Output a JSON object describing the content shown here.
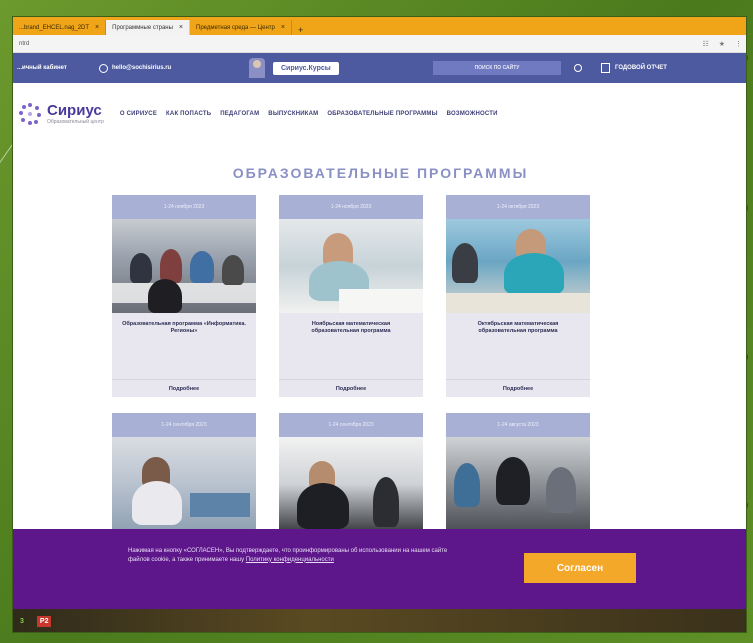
{
  "browser": {
    "tabs": [
      {
        "label": "...brand_EHCEL.nag_2DT",
        "active": false
      },
      {
        "label": "Программные страны",
        "active": true
      },
      {
        "label": "Предметная среда — Центр",
        "active": false
      }
    ],
    "new_tab": "+",
    "address": "ntrd"
  },
  "topbar": {
    "cabinet": "...ичный кабинет",
    "email": "hello@sochisirius.ru",
    "brand_button": "Сириус.Курсы",
    "search_placeholder": "ПОИСК ПО САЙТУ",
    "report": "ГОДОВОЙ ОТЧЕТ"
  },
  "site": {
    "logo_name": "Сириус",
    "logo_sub": "Образовательный центр",
    "nav": [
      "О СИРИУСЕ",
      "КАК ПОПАСТЬ",
      "ПЕДАГОГАМ",
      "ВЫПУСКНИКАМ",
      "ОБРАЗОВАТЕЛЬНЫЕ ПРОГРАММЫ",
      "ВОЗМОЖНОСТИ"
    ]
  },
  "page_title": "ОБРАЗОВАТЕЛЬНЫЕ ПРОГРАММЫ",
  "cards": [
    {
      "date": "1-24 ноября 2023",
      "title": "Образовательная программа «Информатика. Регионы»",
      "more": "Подробнее"
    },
    {
      "date": "1-24 ноября 2023",
      "title": "Ноябрьская математическая образовательная программа",
      "more": "Подробнее"
    },
    {
      "date": "1-24 октября 2023",
      "title": "Октябрьская математическая образовательная программа",
      "more": "Подробнее"
    },
    {
      "date": "1-24 сентября 2023",
      "title": "",
      "more": ""
    },
    {
      "date": "1-24 сентября 2023",
      "title": "",
      "more": ""
    },
    {
      "date": "1-24 августа 2023",
      "title": "",
      "more": ""
    }
  ],
  "cookie": {
    "text": "Нажимая на кнопку «СОГЛАСЕН», Вы подтверждаете, что проинформированы об использовании на нашем сайте файлов cookie, а также принимаете нашу",
    "link": "Политику конфиденциальности",
    "button": "Согласен"
  },
  "taskbar": {
    "item_a": "3",
    "item_b": "P2"
  },
  "colors": {
    "frame": "#5a8a24",
    "topbar": "#4d5aa0",
    "cookie_bg": "#5d178a",
    "cookie_button": "#f3a82a",
    "title": "#8a90c4"
  }
}
